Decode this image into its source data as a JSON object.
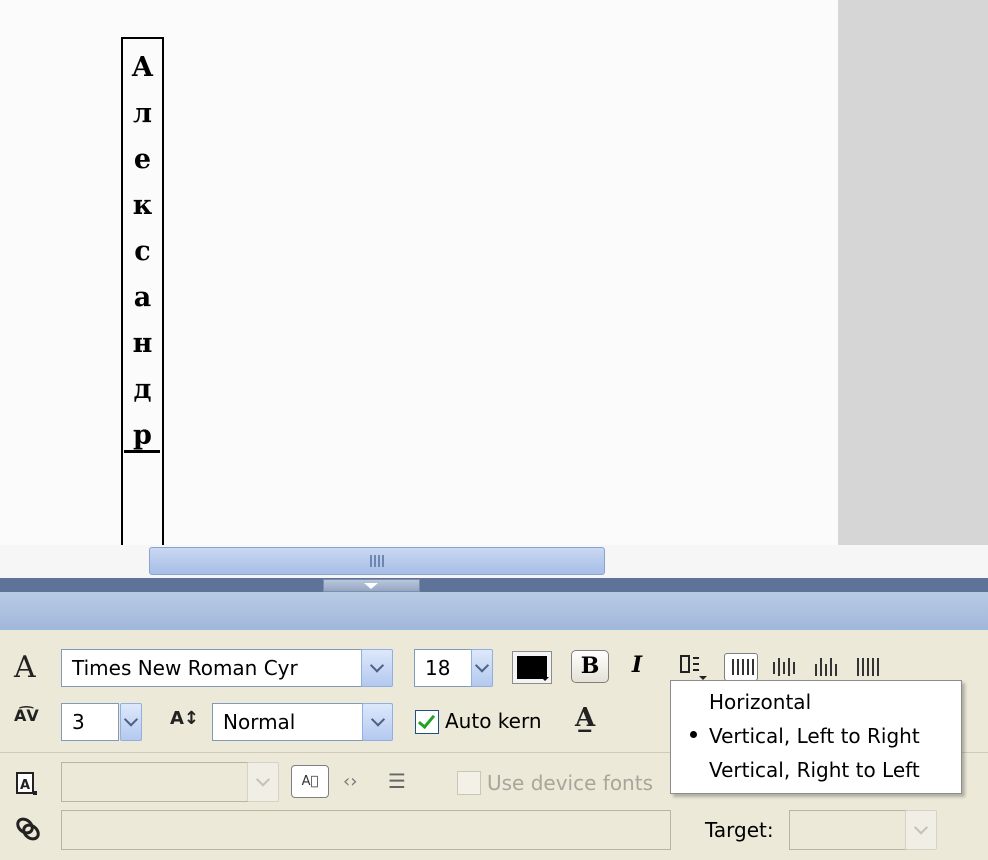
{
  "canvas": {
    "vertical_text_letters": [
      "А",
      "л",
      "е",
      "к",
      "с",
      "а",
      "н",
      "д",
      "р"
    ]
  },
  "properties": {
    "font_family": "Times New Roman Cyr",
    "font_size": "18",
    "text_color": "#000000",
    "bold_label": "B",
    "italic_label": "I",
    "letter_spacing": "3",
    "character_position": "Normal",
    "auto_kern_label": "Auto kern",
    "auto_kern_checked": true,
    "use_device_fonts_label": "Use device fonts",
    "target_label": "Target:",
    "url_link": ""
  },
  "orientation_menu": {
    "items": [
      "Horizontal",
      "Vertical, Left to Right",
      "Vertical, Right to Left"
    ],
    "selected": "Vertical, Left to Right"
  },
  "icons": {
    "font": "A",
    "tracking": "A͡V",
    "baseline": "A↕",
    "bold": "B",
    "italic": "I",
    "rotate": "A̲",
    "link": "⛓",
    "code": "‹›",
    "list": "☰"
  },
  "colors": {
    "panel_bg": "#ece9d8",
    "divider": "#5d7397",
    "dropdown_accent": "#b4c9ef"
  }
}
